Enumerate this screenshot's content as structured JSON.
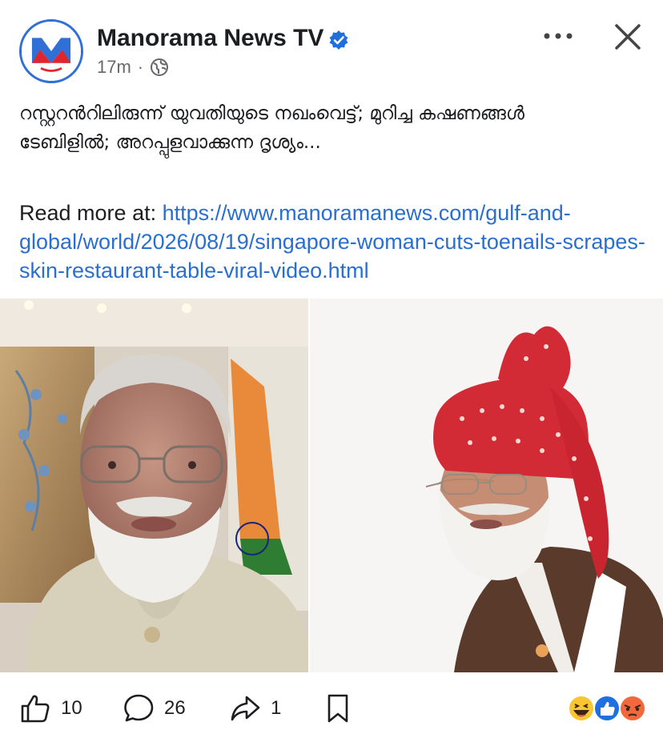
{
  "post": {
    "page_name": "Manorama News TV",
    "time": "17m",
    "separator": "·",
    "text_line1": "റസ്റ്ററൻറിലിരുന്ന് യുവതിയുടെ നഖംവെട്ട്; മുറിച്ച കഷണങ്ങൾ",
    "text_line2": "ടേബിളിൽ; അറപ്പുളവാക്കുന്ന ദൃശ്യം...",
    "read_more_label": "Read more at: ",
    "link": "https://www.manoramanews.com/gulf-and-global/world/2026/08/19/singapore-woman-cuts-toenails-scrapes-skin-restaurant-table-viral-video.html"
  },
  "icons": {
    "avatar": "manorama-logo",
    "verified": "verified-badge-icon",
    "audience": "globe-icon",
    "more": "more-icon",
    "close": "close-icon",
    "like": "thumbs-up-icon",
    "comment": "comment-icon",
    "share": "share-icon",
    "save": "bookmark-icon"
  },
  "actions": {
    "likes": "10",
    "comments": "26",
    "shares": "1"
  },
  "colors": {
    "accent_blue": "#2a6fcf",
    "brand_red": "#e0262c",
    "text": "#1c1e21",
    "muted": "#65676b"
  }
}
